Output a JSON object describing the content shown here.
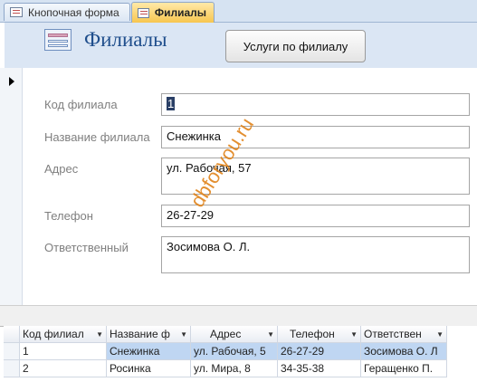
{
  "tabs": [
    {
      "label": "Кнопочная форма",
      "active": false
    },
    {
      "label": "Филиалы",
      "active": true
    }
  ],
  "header": {
    "title": "Филиалы",
    "button_label": "Услуги по филиалу"
  },
  "form": {
    "fields": [
      {
        "label": "Код филиала",
        "value": "1"
      },
      {
        "label": "Название филиала",
        "value": "Снежинка"
      },
      {
        "label": "Адрес",
        "value": "ул. Рабочая, 57"
      },
      {
        "label": "Телефон",
        "value": "26-27-29"
      },
      {
        "label": "Ответственный",
        "value": "Зосимова О. Л."
      }
    ]
  },
  "watermark": "dbforyou.ru",
  "datasheet": {
    "columns": [
      "Код филиал",
      "Название ф",
      "Адрес",
      "Телефон",
      "Ответствен"
    ],
    "rows": [
      [
        "1",
        "Снежинка",
        "ул. Рабочая, 5",
        "26-27-29",
        "Зосимова О. Л"
      ],
      [
        "2",
        "Росинка",
        "ул. Мира, 8",
        "34-35-38",
        "Геращенко П."
      ]
    ]
  },
  "colors": {
    "active_tab": "#f7c650",
    "header_bg": "#dbe6f4",
    "title": "#1f4e8c",
    "selected_row": "#bfd6f2",
    "watermark": "#e0831a"
  }
}
